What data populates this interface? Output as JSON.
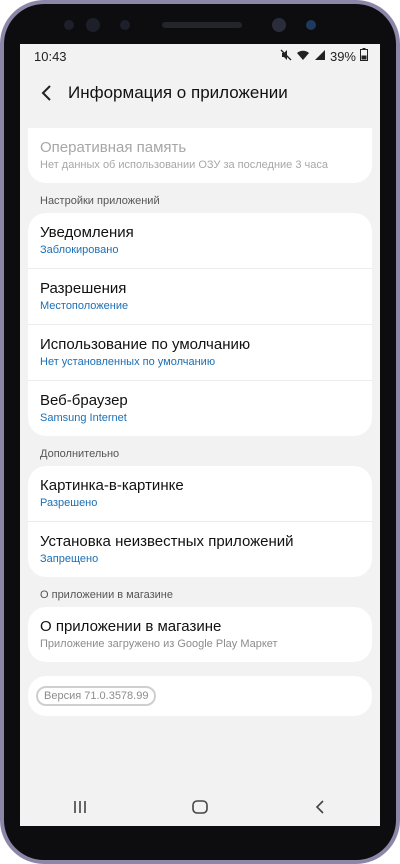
{
  "status_bar": {
    "time": "10:43",
    "battery_percent": "39%",
    "icons": [
      "mute-icon",
      "wifi-icon",
      "signal-icon",
      "battery-icon"
    ]
  },
  "header": {
    "title": "Информация о приложении",
    "back_icon": "back-arrow-icon"
  },
  "memory": {
    "title": "Оперативная память",
    "subtitle": "Нет данных об использовании ОЗУ за последние 3 часа"
  },
  "sections": {
    "app_settings": {
      "label": "Настройки приложений",
      "items": [
        {
          "title": "Уведомления",
          "subtitle": "Заблокировано"
        },
        {
          "title": "Разрешения",
          "subtitle": "Местоположение"
        },
        {
          "title": "Использование по умолчанию",
          "subtitle": "Нет установленных по умолчанию"
        },
        {
          "title": "Веб-браузер",
          "subtitle": "Samsung Internet"
        }
      ]
    },
    "advanced": {
      "label": "Дополнительно",
      "items": [
        {
          "title": "Картинка-в-картинке",
          "subtitle": "Разрешено"
        },
        {
          "title": "Установка неизвестных приложений",
          "subtitle": "Запрещено"
        }
      ]
    },
    "store": {
      "label": "О приложении в магазине",
      "items": [
        {
          "title": "О приложении в магазине",
          "subtitle": "Приложение загружено из Google Play Маркет"
        }
      ]
    }
  },
  "version": "Версия 71.0.3578.99",
  "colors": {
    "accent_blue": "#1b6fb5",
    "background": "#f2f2f2",
    "card": "#ffffff",
    "phone_frame": "#8d86a8"
  },
  "navbar": {
    "icons": [
      "recents-icon",
      "home-icon",
      "back-icon"
    ]
  }
}
